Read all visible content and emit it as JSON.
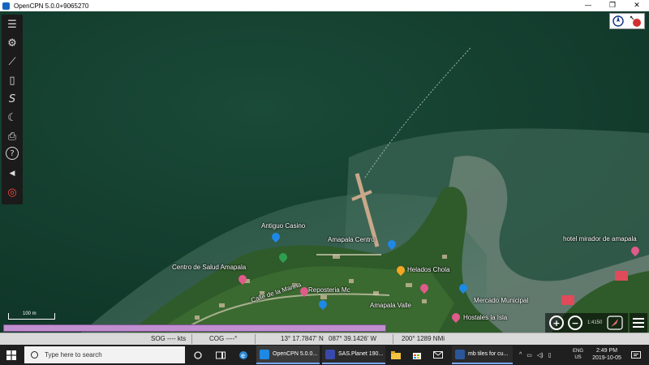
{
  "window": {
    "title": "OpenCPN 5.0.0+9065270",
    "controls": [
      "—",
      "❐",
      "✕"
    ]
  },
  "toolbar": {
    "items": [
      {
        "name": "menu-icon",
        "glyph": "☰"
      },
      {
        "name": "settings-icon",
        "glyph": "⚙"
      },
      {
        "name": "route-icon",
        "glyph": "⟋"
      },
      {
        "name": "route-manager-icon",
        "glyph": "▯"
      },
      {
        "name": "track-icon",
        "glyph": "S"
      },
      {
        "name": "moon-tide-icon",
        "glyph": "☾"
      },
      {
        "name": "print-icon",
        "glyph": "⎙"
      },
      {
        "name": "help-icon",
        "glyph": "?"
      },
      {
        "name": "sound-icon",
        "glyph": "◀"
      },
      {
        "name": "mob-icon",
        "glyph": "◎"
      }
    ]
  },
  "map": {
    "labels": {
      "antiguo": "Antiguo Casino",
      "amapala_center": "Amapala Centro",
      "centro_salud": "Centro de Salud Amapala",
      "calle_marina": "Calle de la Marina",
      "reposteria": "Reposteria Mc",
      "helados": "Helados Chola",
      "mercado": "Mercado Municipal",
      "amapala_valle": "Amapala Valle",
      "hostales": "Hostales la Isla",
      "hotel": "hotel mirador de amapala"
    },
    "scale_label": "100 m",
    "scale_ratio": "1:4150"
  },
  "status": {
    "sog": "SOG ---- kts",
    "cog": "COG ----°",
    "lat": "13° 17.7847' N",
    "lon": "087° 39.1426' W",
    "brg_dist": "200°  1289 NMi"
  },
  "taskbar": {
    "search_placeholder": "Type here to search",
    "apps": [
      {
        "label": "OpenCPN 5.0.0...",
        "color": "#1e88e5"
      },
      {
        "label": "SAS.Planet 190...",
        "color": "#3949ab"
      },
      {
        "label": "mb tiles for cu...",
        "color": "#2b579a"
      }
    ],
    "lang": "ENG",
    "region": "US",
    "time": "2:49 PM",
    "date": "2019-10-05"
  },
  "colors": {
    "pink_bar": "#c08fd0",
    "pin_pink": "#e05a8a",
    "pin_blue": "#1e88e5",
    "pin_orange": "#f5a623",
    "pin_green": "#2e9e4f"
  }
}
